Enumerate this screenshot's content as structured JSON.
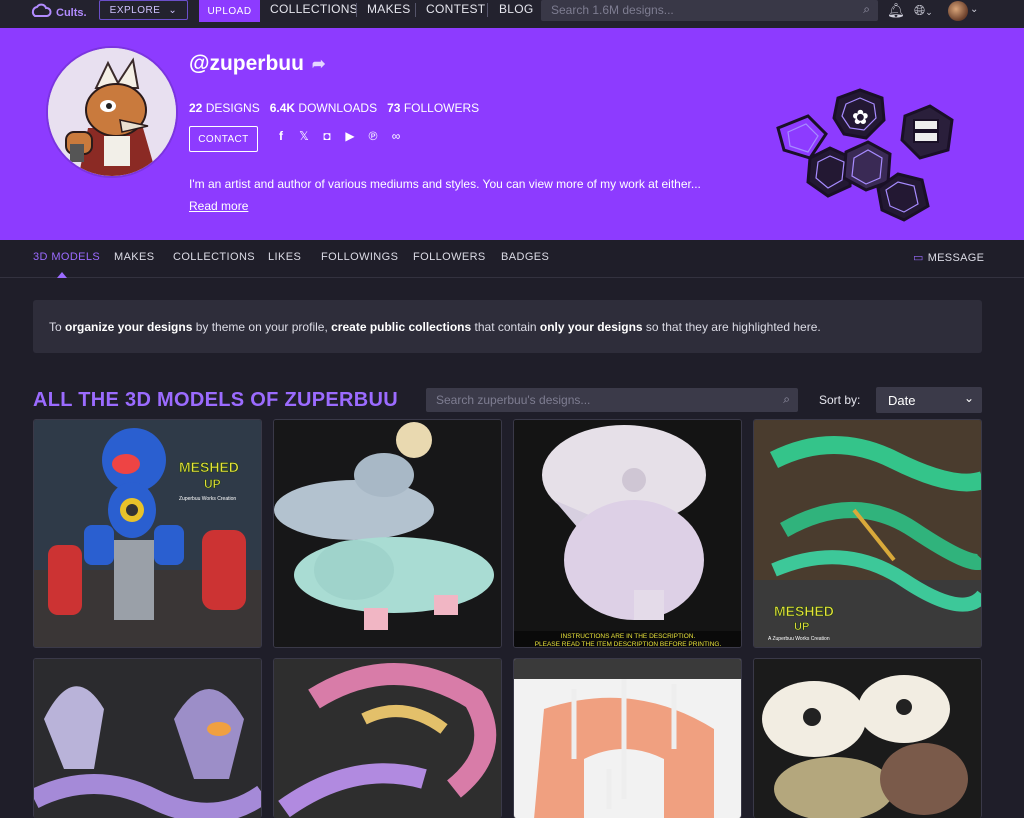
{
  "nav": {
    "brand": "Cults.",
    "explore_label": "EXPLORE",
    "upload_label": "UPLOAD",
    "links": [
      "COLLECTIONS",
      "MAKES",
      "CONTEST",
      "BLOG"
    ],
    "search_placeholder": "Search 1.6M designs..."
  },
  "profile": {
    "handle": "@zuperbuu",
    "designs_count": "22",
    "designs_label": "DESIGNS",
    "downloads_count": "6.4K",
    "downloads_label": "DOWNLOADS",
    "followers_count": "73",
    "followers_label": "FOLLOWERS",
    "contact_label": "CONTACT",
    "social_icons": [
      "facebook-icon",
      "x-icon",
      "instagram-icon",
      "youtube-icon",
      "patreon-icon",
      "link-icon"
    ],
    "bio": "I'm an artist and author of various mediums and styles. You can view more of my work at either...",
    "read_more": "Read more"
  },
  "tabs": [
    "3D MODELS",
    "MAKES",
    "COLLECTIONS",
    "LIKES",
    "FOLLOWINGS",
    "FOLLOWERS",
    "BADGES"
  ],
  "message_label": "MESSAGE",
  "info": {
    "t1": "To ",
    "b1": "organize your designs",
    "t2": " by theme on your profile, ",
    "b2": "create public collections",
    "t3": " that contain ",
    "b3": "only your designs",
    "t4": " so that they are highlighted here."
  },
  "section": {
    "title": "ALL THE 3D MODELS OF ZUPERBUU",
    "search_placeholder": "Search zuperbuu's designs...",
    "sort_label": "Sort by:",
    "sort_value": "Date"
  },
  "cards": {
    "c1_logo_line1": "MESHED",
    "c1_logo_line2": "UP",
    "c1_logo_sub": "Zuperbuu Works Creation",
    "c3_caption_1": "INSTRUCTIONS ARE IN THE DESCRIPTION.",
    "c3_caption_2": "PLEASE READ THE ITEM DESCRIPTION BEFORE PRINTING.",
    "c4_logo_line1": "MESHED",
    "c4_logo_line2": "UP",
    "c4_logo_sub": "A Zuperbuu Works Creation"
  },
  "colors": {
    "accent": "#8d3bff",
    "page_bg": "#1f1e29",
    "link_purple": "#9b6bff"
  }
}
